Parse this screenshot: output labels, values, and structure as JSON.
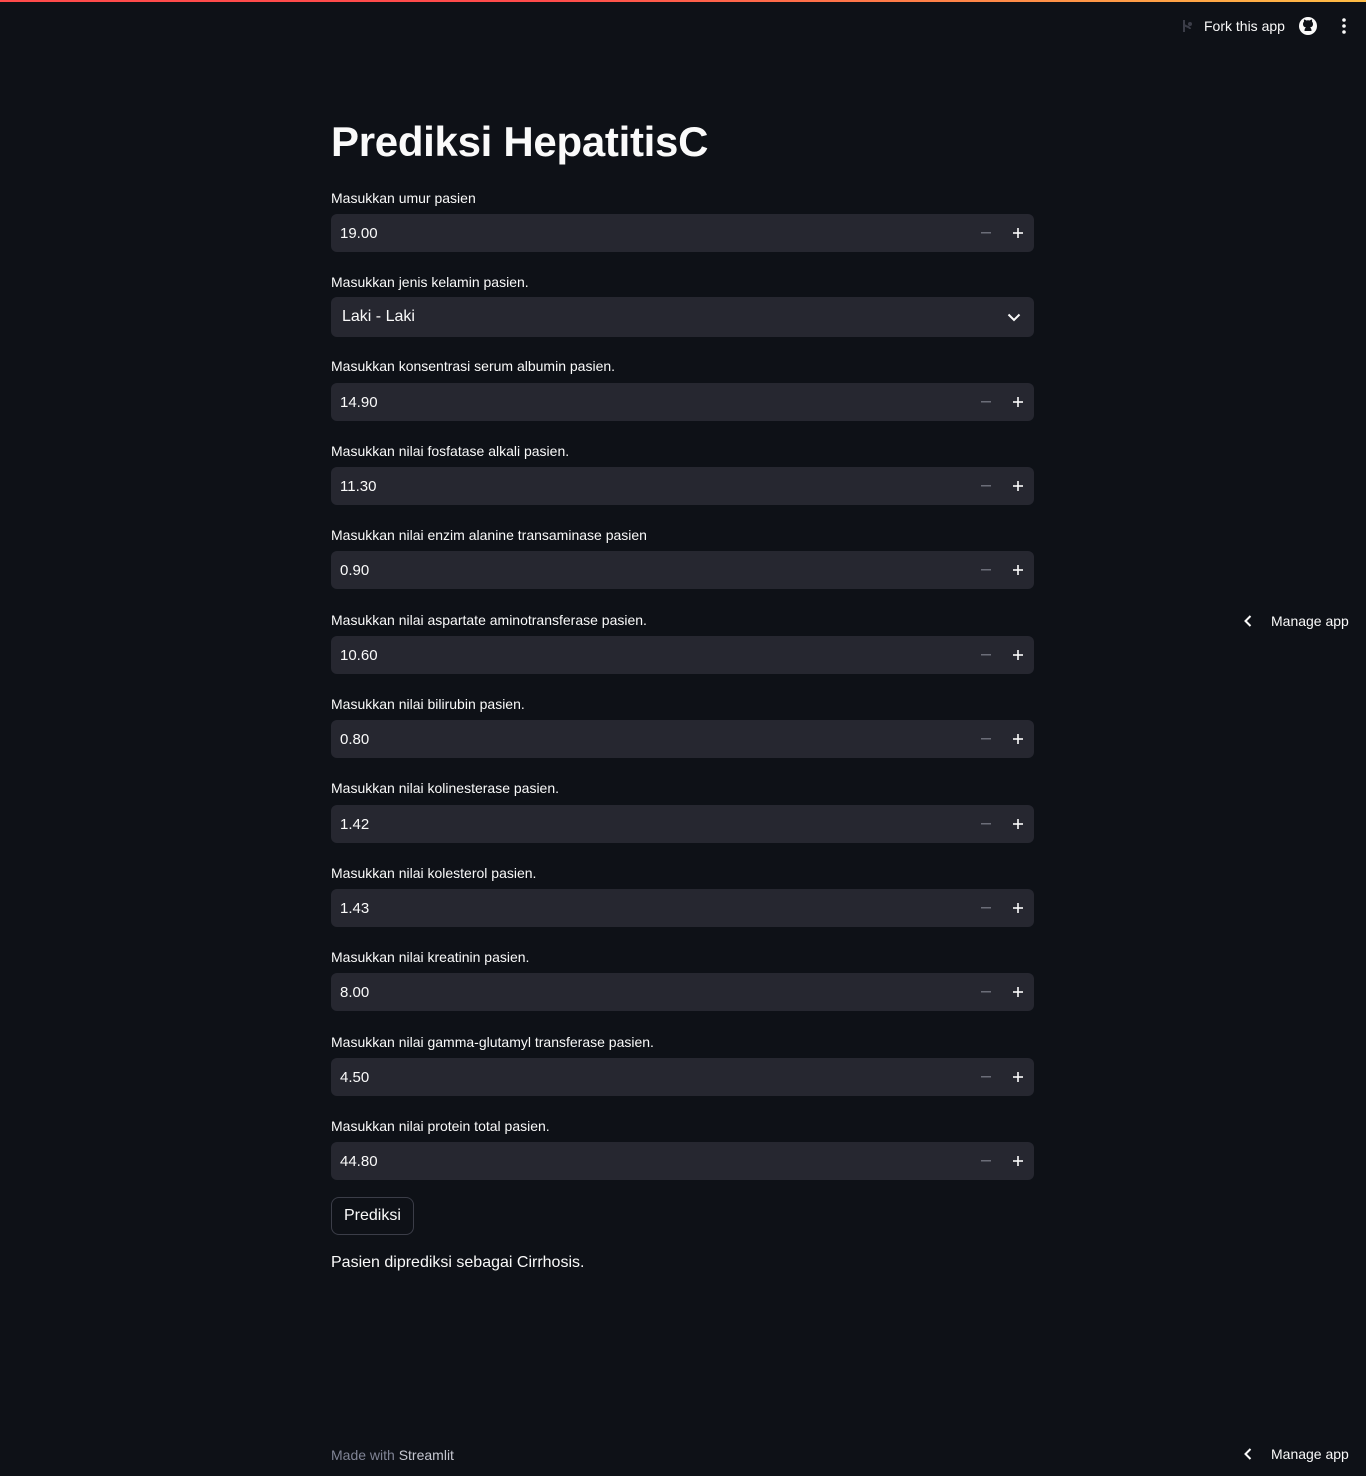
{
  "header": {
    "fork_label": "Fork this app",
    "github_icon": "github-icon",
    "menu_icon": "kebab-menu-icon"
  },
  "page": {
    "title": "Prediksi HepatitisC"
  },
  "form": {
    "age": {
      "label": "Masukkan umur pasien",
      "value": "19.00"
    },
    "sex": {
      "label": "Masukkan jenis kelamin pasien.",
      "value": "Laki - Laki"
    },
    "albumin": {
      "label": "Masukkan konsentrasi serum albumin pasien.",
      "value": "14.90"
    },
    "alp": {
      "label": "Masukkan nilai fosfatase alkali pasien.",
      "value": "11.30"
    },
    "alt": {
      "label": "Masukkan nilai enzim alanine transaminase pasien",
      "value": "0.90"
    },
    "ast": {
      "label": "Masukkan nilai aspartate aminotransferase pasien.",
      "value": "10.60"
    },
    "bilirubin": {
      "label": "Masukkan nilai bilirubin pasien.",
      "value": "0.80"
    },
    "che": {
      "label": "Masukkan nilai kolinesterase pasien.",
      "value": "1.42"
    },
    "chol": {
      "label": "Masukkan nilai kolesterol pasien.",
      "value": "1.43"
    },
    "crea": {
      "label": "Masukkan nilai kreatinin pasien.",
      "value": "8.00"
    },
    "ggt": {
      "label": "Masukkan nilai gamma-glutamyl transferase pasien.",
      "value": "4.50"
    },
    "prot": {
      "label": "Masukkan nilai protein total pasien.",
      "value": "44.80"
    }
  },
  "actions": {
    "predict_label": "Prediksi"
  },
  "result": {
    "text": "Pasien diprediksi sebagai Cirrhosis."
  },
  "manage": {
    "label": "Manage app"
  },
  "footer": {
    "prefix": "Made with",
    "brand": "Streamlit"
  },
  "colors": {
    "background": "#0e1117",
    "input_bg": "#262730",
    "accent_red": "#ff4b4b",
    "accent_yellow": "#ffbd45"
  }
}
